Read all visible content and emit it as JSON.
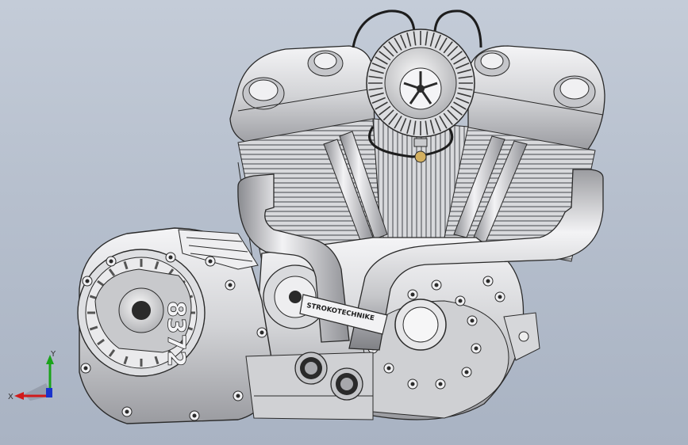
{
  "viewport": {
    "background_top": "#c4ccd8",
    "background_bottom": "#a9b3c3"
  },
  "model": {
    "engine_number": "8372",
    "collar_text": "STROKOTECHNIKE",
    "part_colors": {
      "metal_light": "#e8e8ea",
      "metal_mid": "#c9cacd",
      "metal_dark": "#8c8d91",
      "outline": "#2a2a2a",
      "brass": "#d4b060"
    }
  },
  "triad": {
    "x_label": "X",
    "y_label": "Y",
    "x_color": "#d11a1a",
    "y_color": "#1aa31a",
    "z_color": "#1a33cc"
  }
}
